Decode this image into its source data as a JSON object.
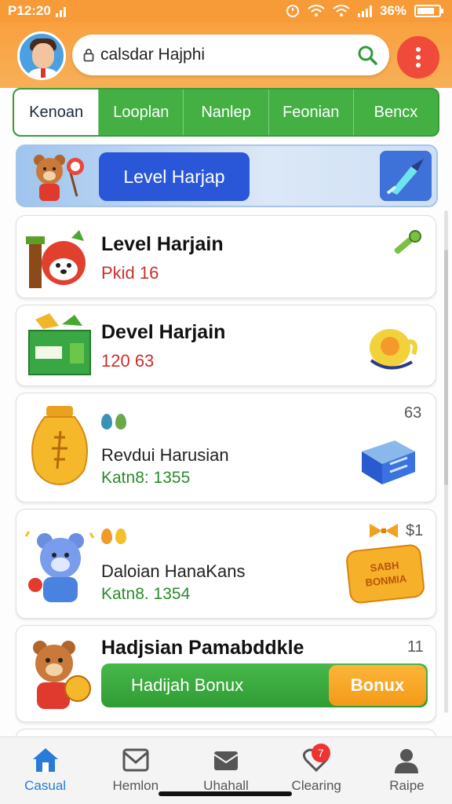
{
  "status": {
    "time": "P12:20",
    "battery": "36%",
    "battery_level": 0.8
  },
  "search": {
    "value": "calsdar Hajphi"
  },
  "tabs": [
    {
      "label": "Kenoan",
      "active": true
    },
    {
      "label": "Looplan",
      "active": false
    },
    {
      "label": "Nanlep",
      "active": false
    },
    {
      "label": "Feonian",
      "active": false
    },
    {
      "label": "Bencx",
      "active": false
    }
  ],
  "banner": {
    "button_label": "Level Harjap"
  },
  "cards": [
    {
      "title": "Level Harjain",
      "sub": "Pkid 16"
    },
    {
      "title": "Devel Harjain",
      "sub": "120 63"
    },
    {
      "corner": "63",
      "name": "Revdui Harusian",
      "stat": "Katn8: 1355"
    },
    {
      "corner": "$1",
      "name": "Daloian HanaKans",
      "stat": "Katn8. 1354",
      "badge_lines": [
        "SABH",
        "BONMIA"
      ]
    },
    {
      "title": "Hadjsian Pamabddkle",
      "corner": "11",
      "bar_label": "Hadijah Bonux",
      "button_label": "Bonux"
    }
  ],
  "nav": [
    {
      "label": "Casual",
      "icon": "home-icon",
      "active": true
    },
    {
      "label": "Hemlon",
      "icon": "mail-icon",
      "active": false
    },
    {
      "label": "Uhahall",
      "icon": "inbox-icon",
      "active": false
    },
    {
      "label": "Clearing",
      "icon": "heart-icon",
      "active": false,
      "badge": "7"
    },
    {
      "label": "Raipe",
      "icon": "profile-icon",
      "active": false
    }
  ],
  "colors": {
    "header": "#f79a38",
    "tabs": "#44b044",
    "accent_blue": "#2a56d8",
    "stat_green": "#2c8a2c",
    "badge_red": "#e33"
  }
}
